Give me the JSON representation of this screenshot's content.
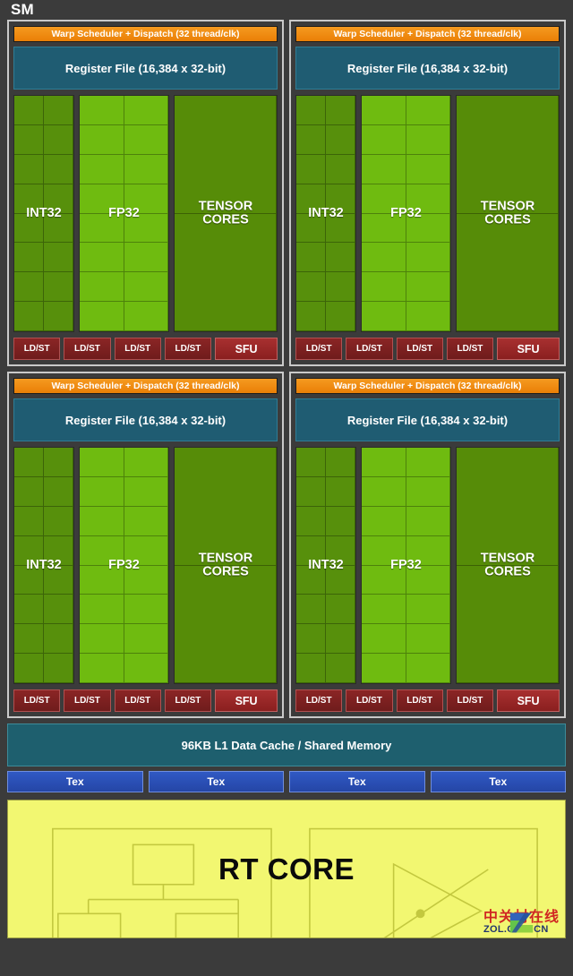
{
  "title": "SM",
  "colors": {
    "background": "#3b3b3b",
    "warp_scheduler": "#f08a10",
    "register_file": "#1f5c72",
    "int32": "#57900c",
    "fp32": "#6fbb10",
    "tensor_cores": "#568c08",
    "ldst": "#7d2020",
    "sfu": "#9a2424",
    "l1_cache": "#1e5f6e",
    "tex": "#2a4fb5",
    "rt_core": "#f2f771",
    "panel_border": "#c9c9c9"
  },
  "processing_blocks": [
    {
      "id": "block-0",
      "warp_scheduler": "Warp Scheduler + Dispatch (32 thread/clk)",
      "register_file": "Register File (16,384 x 32-bit)",
      "units": [
        {
          "name": "INT32",
          "label": "INT32",
          "columns": 2,
          "rows": 8
        },
        {
          "name": "FP32",
          "label": "FP32",
          "columns": 2,
          "rows": 8
        },
        {
          "name": "TENSOR CORES",
          "label": "TENSOR\nCORES",
          "columns": 1,
          "rows": 2
        }
      ],
      "ldst": [
        "LD/ST",
        "LD/ST",
        "LD/ST",
        "LD/ST"
      ],
      "sfu": "SFU"
    },
    {
      "id": "block-1",
      "warp_scheduler": "Warp Scheduler + Dispatch (32 thread/clk)",
      "register_file": "Register File (16,384 x 32-bit)",
      "units": [
        {
          "name": "INT32",
          "label": "INT32",
          "columns": 2,
          "rows": 8
        },
        {
          "name": "FP32",
          "label": "FP32",
          "columns": 2,
          "rows": 8
        },
        {
          "name": "TENSOR CORES",
          "label": "TENSOR\nCORES",
          "columns": 1,
          "rows": 2
        }
      ],
      "ldst": [
        "LD/ST",
        "LD/ST",
        "LD/ST",
        "LD/ST"
      ],
      "sfu": "SFU"
    },
    {
      "id": "block-2",
      "warp_scheduler": "Warp Scheduler + Dispatch (32 thread/clk)",
      "register_file": "Register File (16,384 x 32-bit)",
      "units": [
        {
          "name": "INT32",
          "label": "INT32",
          "columns": 2,
          "rows": 8
        },
        {
          "name": "FP32",
          "label": "FP32",
          "columns": 2,
          "rows": 8
        },
        {
          "name": "TENSOR CORES",
          "label": "TENSOR\nCORES",
          "columns": 1,
          "rows": 2
        }
      ],
      "ldst": [
        "LD/ST",
        "LD/ST",
        "LD/ST",
        "LD/ST"
      ],
      "sfu": "SFU"
    },
    {
      "id": "block-3",
      "warp_scheduler": "Warp Scheduler + Dispatch (32 thread/clk)",
      "register_file": "Register File (16,384 x 32-bit)",
      "units": [
        {
          "name": "INT32",
          "label": "INT32",
          "columns": 2,
          "rows": 8
        },
        {
          "name": "FP32",
          "label": "FP32",
          "columns": 2,
          "rows": 8
        },
        {
          "name": "TENSOR CORES",
          "label": "TENSOR\nCORES",
          "columns": 1,
          "rows": 2
        }
      ],
      "ldst": [
        "LD/ST",
        "LD/ST",
        "LD/ST",
        "LD/ST"
      ],
      "sfu": "SFU"
    }
  ],
  "l1_cache": "96KB L1 Data Cache / Shared Memory",
  "tex_units": [
    "Tex",
    "Tex",
    "Tex",
    "Tex"
  ],
  "rt_core": {
    "label": "RT CORE",
    "left_diagram": "bvh-tree-icon",
    "right_diagram": "ray-triangle-intersection-icon"
  },
  "watermark": {
    "chinese": "中关村在线",
    "english": "ZOL.COM.CN",
    "logo": "zol-z-logo"
  }
}
